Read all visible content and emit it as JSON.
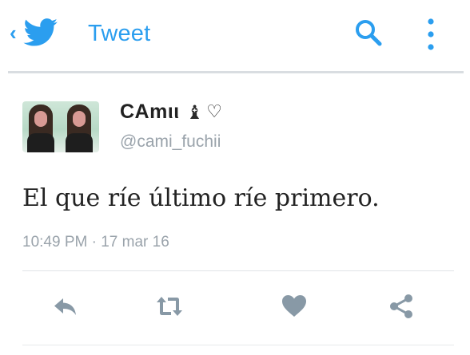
{
  "header": {
    "back_glyph": "‹",
    "title": "Tweet",
    "brand_color": "#2b9eef",
    "icons": [
      "chevron-left-icon",
      "twitter-bird-icon",
      "search-icon",
      "more-vertical-icon"
    ]
  },
  "tweet": {
    "display_name": "CAmιι",
    "display_name_emoji": "♝",
    "display_name_heart": "♡",
    "handle": "@cami_fuchii",
    "text": "El que ríe último ríe primero.",
    "timestamp": "10:49 PM · 17 mar 16",
    "avatar": "profile-photo"
  },
  "actions": {
    "icons": [
      "reply-icon",
      "retweet-icon",
      "like-icon",
      "share-icon"
    ],
    "icon_color": "#8899a6"
  }
}
